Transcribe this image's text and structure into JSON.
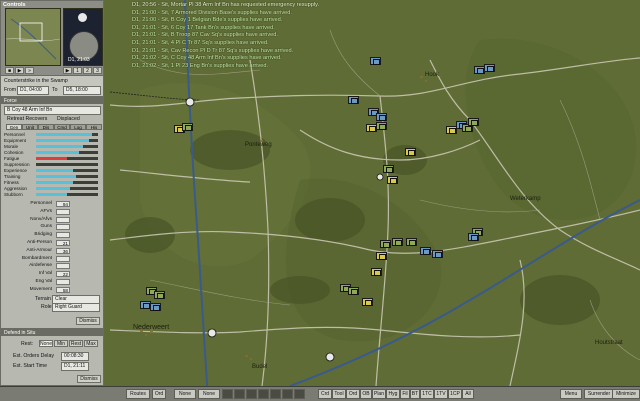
{
  "messages": [
    {
      "text": "D1, 20:56 - Sit, Mortar Pl 38 Arm Inf Bn has requested emergency resupply.",
      "alert": true
    },
    {
      "text": "D1, 21:00 - Sit, 7 Armored Division Base's supplies have arrived."
    },
    {
      "text": "D1, 21:00 - Sit, B Coy 1 Belgian Bde's supplies have arrived."
    },
    {
      "text": "D1, 21:01 - Sit, 6 Coy 17 Tank Bn's supplies have arrived."
    },
    {
      "text": "D1, 21:01 - Sit, B Troop 87 Cav Sq's supplies have arrived."
    },
    {
      "text": "D1, 21:01 - Sit, 4 Pl C Tr 87 Sq's supplies have arrived."
    },
    {
      "text": "D1, 21:01 - Sit, Cav Recon Pl D Tr 87 Sq's supplies have arrived."
    },
    {
      "text": "D1, 21:02 - Sit, C Coy 48 Arm Inf Bn's supplies have arrived."
    },
    {
      "text": "D1, 21:02 - Sit, 1 Pl 23 Eng Bn's supplies have arrived."
    }
  ],
  "controls": {
    "title": "Controls",
    "clock": "D1, 21:03",
    "scenario": "Counterstrike in the Swamp",
    "from_label": "From",
    "from_value": "D1, 04:00",
    "to_label": "To",
    "to_value": "D5, 18:00"
  },
  "unit_panel": {
    "title": "Force",
    "unit_name": "B Coy 48 Arm Inf Bn",
    "status1": "Retreat Recovers",
    "status2": "Displaced",
    "tabs": [
      "Gen",
      "Unit",
      "Dis",
      "Cmd",
      "Log",
      "His"
    ],
    "bars": [
      {
        "label": "Personnel",
        "value": 0.9,
        "color": "#58c0d8"
      },
      {
        "label": "Equipment",
        "value": 0.85,
        "color": "#58c0d8"
      },
      {
        "label": "Morale",
        "value": 0.75,
        "color": "#58c0d8"
      },
      {
        "label": "Cohesion",
        "value": 0.7,
        "color": "#58c0d8"
      },
      {
        "label": "Fatigue",
        "value": 0.5,
        "color": "#d84040"
      },
      {
        "label": "Suppression",
        "value": 0.0,
        "color": "#58c0d8"
      },
      {
        "label": "Experience",
        "value": 0.6,
        "color": "#58c0d8"
      },
      {
        "label": "Training",
        "value": 0.65,
        "color": "#58c0d8"
      },
      {
        "label": "Fitness",
        "value": 0.6,
        "color": "#58c0d8"
      },
      {
        "label": "Aggression",
        "value": 0.55,
        "color": "#58c0d8"
      },
      {
        "label": "Stubborn",
        "value": 0.5,
        "color": "#58c0d8"
      }
    ],
    "values": [
      {
        "label": "Personnel",
        "value": "94"
      },
      {
        "label": "AFVs",
        "value": ""
      },
      {
        "label": "Nonv/Afvs",
        "value": ""
      },
      {
        "label": "Guns",
        "value": ""
      },
      {
        "label": "Bridging",
        "value": ""
      },
      {
        "label": "Anti-Person",
        "value": "21"
      },
      {
        "label": "Anti-Armour",
        "value": "36"
      },
      {
        "label": "Bombardment",
        "value": ""
      },
      {
        "label": "Airdefense",
        "value": ""
      },
      {
        "label": "Inf Val",
        "value": "22"
      },
      {
        "label": "Eng Val",
        "value": ""
      },
      {
        "label": "Movement",
        "value": "58"
      }
    ],
    "terrain_label": "Terrain",
    "terrain_value": "Clear",
    "role_label": "Role",
    "role_value": "Right Guard",
    "dismiss": "Dismiss"
  },
  "defend_panel": {
    "title": "Defend in Situ",
    "rest_label": "Rest:",
    "rest_options": [
      "None",
      "Min",
      "Rest",
      "Max"
    ],
    "orders_delay_label": "Est. Orders Delay",
    "orders_delay": "00:08:30",
    "start_time_label": "Est. Start Time",
    "start_time": "D1, 21:11",
    "dismiss": "Dismiss"
  },
  "map_labels": {
    "towns": [
      "Hook",
      "Weterkamp",
      "Nederweert",
      "Budel",
      "Ponteweg",
      "Houtstraat"
    ]
  },
  "bottom_bar": {
    "buttons": [
      "Routes",
      "Ord",
      "None",
      "None",
      "Crd",
      "Tool",
      "Ord",
      "OB",
      "Plan",
      "Hyg",
      "Fil",
      "BT",
      "1TC",
      "1TV",
      "1CP",
      "All",
      "Menu",
      "Surrender",
      "Minimize"
    ]
  }
}
